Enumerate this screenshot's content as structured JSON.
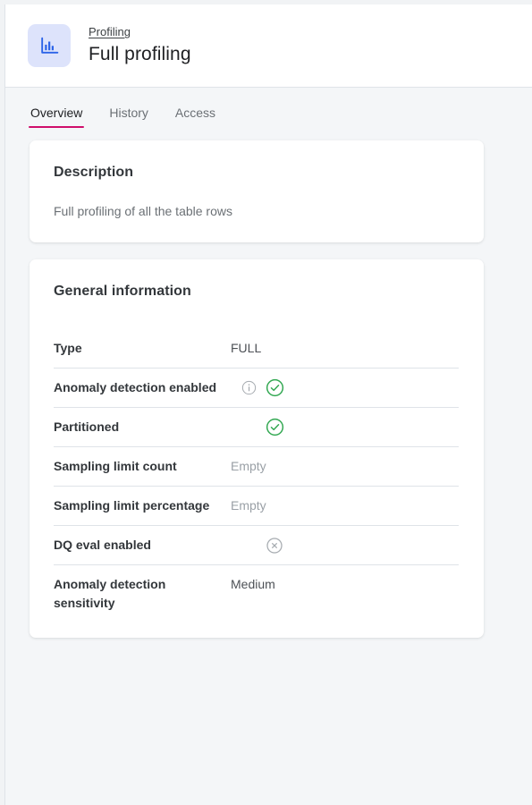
{
  "header": {
    "icon": "bar-chart-icon",
    "breadcrumb": "Profiling",
    "title": "Full profiling"
  },
  "tabs": [
    {
      "label": "Overview",
      "active": true
    },
    {
      "label": "History",
      "active": false
    },
    {
      "label": "Access",
      "active": false
    }
  ],
  "description_card": {
    "title": "Description",
    "text": "Full profiling of all the table rows"
  },
  "general_card": {
    "title": "General information",
    "rows": [
      {
        "label": "Type",
        "value": "FULL",
        "kind": "text",
        "hint": false
      },
      {
        "label": "Anomaly detection enabled",
        "value": "",
        "kind": "check",
        "hint": true,
        "hint_icon": "info-icon"
      },
      {
        "label": "Partitioned",
        "value": "",
        "kind": "check",
        "hint": false
      },
      {
        "label": "Sampling limit count",
        "value": "Empty",
        "kind": "empty",
        "hint": false
      },
      {
        "label": "Sampling limit percentage",
        "value": "Empty",
        "kind": "empty",
        "hint": false
      },
      {
        "label": "DQ eval enabled",
        "value": "",
        "kind": "cross",
        "hint": false
      },
      {
        "label": "Anomaly detection sensitivity",
        "value": "Medium",
        "kind": "text",
        "hint": false
      }
    ]
  },
  "colors": {
    "accent_tab_underline": "#cf0d6b",
    "icon_tile_bg": "#dde3fb",
    "icon_blue": "#2b63e8",
    "status_green": "#33a852",
    "status_grey": "#9aa0a6",
    "page_bg": "#f4f6f8",
    "card_bg": "#ffffff",
    "divider": "#dfe3e8"
  }
}
